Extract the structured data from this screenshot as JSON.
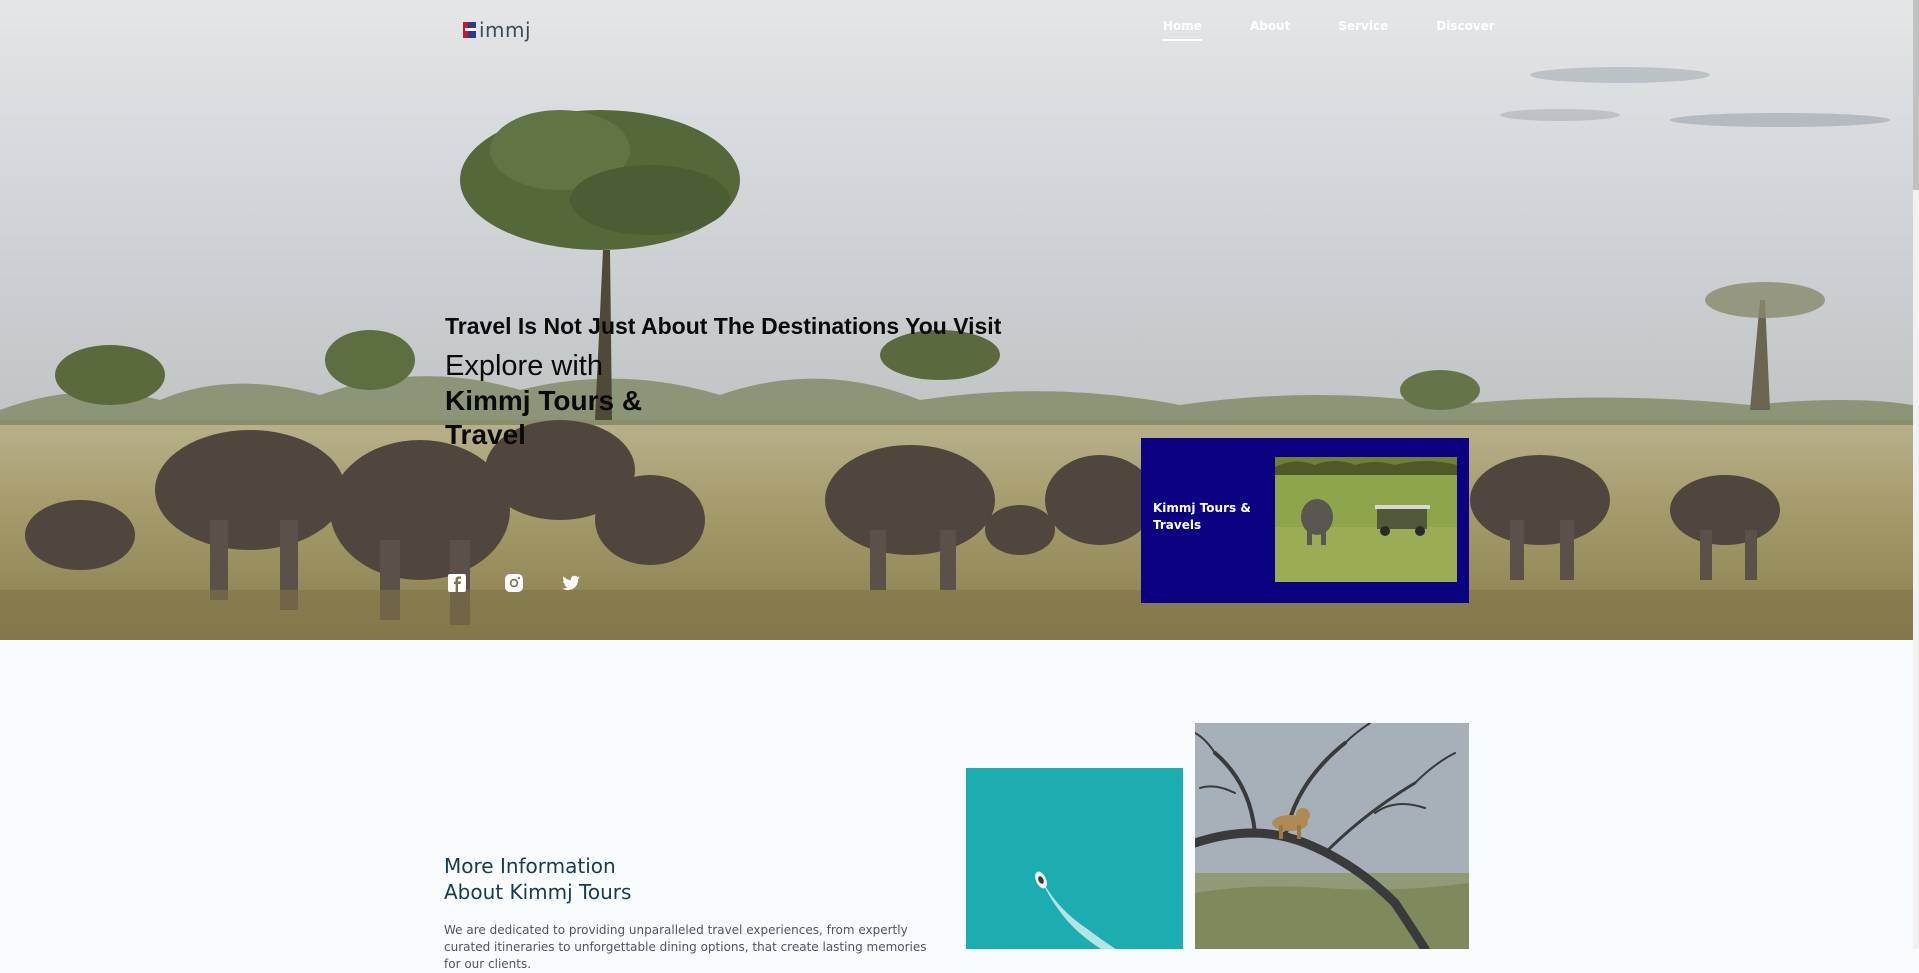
{
  "header": {
    "logo_text": "immj",
    "nav": [
      {
        "label": "Home",
        "active": true
      },
      {
        "label": "About",
        "active": false
      },
      {
        "label": "Service",
        "active": false
      },
      {
        "label": "Discover",
        "active": false
      }
    ]
  },
  "hero": {
    "subtitle": "Travel Is Not Just About The Destinations You Visit",
    "title_line1": "Explore with",
    "title_line2": "Kimmj Tours & Travel",
    "socials": [
      "facebook-icon",
      "instagram-icon",
      "twitter-icon"
    ],
    "promo_card": {
      "text": "Kimmj Tours & Travels",
      "background": "#0c0181"
    }
  },
  "about": {
    "title_line1": "More Information",
    "title_line2": "About Kimmj Tours",
    "text": "We are dedicated to providing unparalleled travel experiences, from expertly curated itineraries to unforgettable dining options, that create lasting memories for our clients."
  },
  "colors": {
    "accent": "#0c0181",
    "heading": "#173a4e",
    "page_bg": "#f8fcff"
  }
}
